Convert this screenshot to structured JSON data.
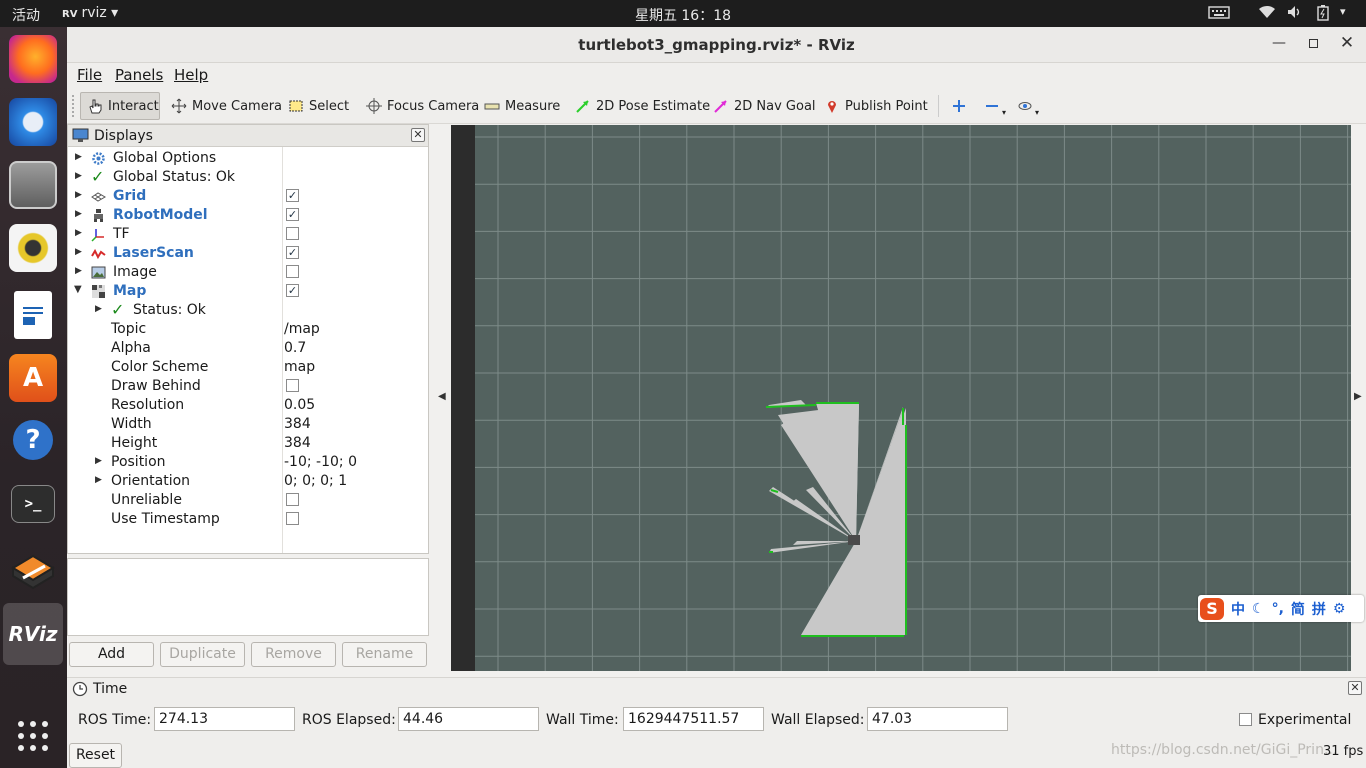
{
  "topbar": {
    "activities": "活动",
    "app_menu": "rviz ▾",
    "clock": "星期五 16：18"
  },
  "window": {
    "title": "turtlebot3_gmapping.rviz* - RViz"
  },
  "menu": {
    "file": "File",
    "panels": "Panels",
    "help": "Help"
  },
  "toolbar": {
    "interact": "Interact",
    "move_camera": "Move Camera",
    "select": "Select",
    "focus_camera": "Focus Camera",
    "measure": "Measure",
    "pose_estimate": "2D Pose Estimate",
    "nav_goal": "2D Nav Goal",
    "publish_point": "Publish Point"
  },
  "displays": {
    "title": "Displays",
    "items": [
      {
        "name": "Global Options"
      },
      {
        "name": "Global Status: Ok"
      },
      {
        "name": "Grid",
        "checked": true
      },
      {
        "name": "RobotModel",
        "checked": true
      },
      {
        "name": "TF",
        "checked": false
      },
      {
        "name": "LaserScan",
        "checked": true
      },
      {
        "name": "Image",
        "checked": false
      },
      {
        "name": "Map",
        "checked": true
      }
    ],
    "map_props": {
      "status": "Status: Ok",
      "topic_label": "Topic",
      "topic": "/map",
      "alpha_label": "Alpha",
      "alpha": "0.7",
      "scheme_label": "Color Scheme",
      "scheme": "map",
      "draw_behind_label": "Draw Behind",
      "draw_behind": false,
      "resolution_label": "Resolution",
      "resolution": "0.05",
      "width_label": "Width",
      "width": "384",
      "height_label": "Height",
      "height": "384",
      "position_label": "Position",
      "position": "-10; -10; 0",
      "orientation_label": "Orientation",
      "orientation": "0; 0; 0; 1",
      "unreliable_label": "Unreliable",
      "unreliable": false,
      "timestamp_label": "Use Timestamp",
      "timestamp": false
    },
    "buttons": {
      "add": "Add",
      "duplicate": "Duplicate",
      "remove": "Remove",
      "rename": "Rename"
    }
  },
  "time": {
    "title": "Time",
    "ros_time_label": "ROS Time:",
    "ros_time": "274.13",
    "ros_elapsed_label": "ROS Elapsed:",
    "ros_elapsed": "44.46",
    "wall_time_label": "Wall Time:",
    "wall_time": "1629447511.57",
    "wall_elapsed_label": "Wall Elapsed:",
    "wall_elapsed": "47.03",
    "experimental": "Experimental",
    "reset": "Reset",
    "fps": "31 fps"
  },
  "ime": {
    "logo": "S",
    "items": [
      "中",
      "☾",
      "°,",
      "简",
      "拼",
      "⚙"
    ]
  },
  "watermark": "https://blog.csdn.net/GiGi_Prin...",
  "colors": {
    "viewport_bg": "#53625f",
    "grid": "#7d8b88",
    "map_free": "#c8c8c8",
    "laser": "#22cc22",
    "accent_blue": "#2f6fbd"
  }
}
